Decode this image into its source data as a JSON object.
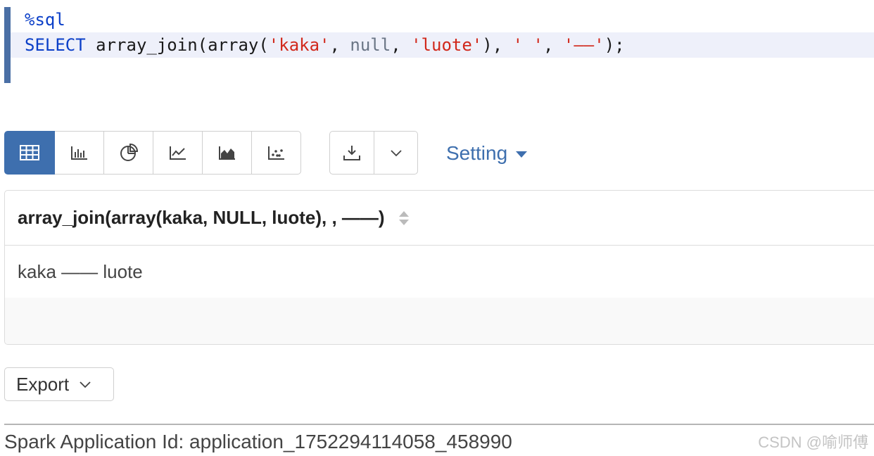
{
  "editor": {
    "line1": "%sql",
    "line2": {
      "kw": "SELECT",
      "p1": " array_join(array(",
      "s1": "'kaka'",
      "p2": ", ",
      "nul": "null",
      "p3": ", ",
      "s2": "'luote'",
      "p4": "), ",
      "s3": "' '",
      "p5": ", ",
      "s4": "'——'",
      "p6": ");"
    }
  },
  "toolbar": {
    "buttons": [
      {
        "icon": "table-icon",
        "active": true
      },
      {
        "icon": "bar-chart-icon",
        "active": false
      },
      {
        "icon": "pie-chart-icon",
        "active": false
      },
      {
        "icon": "line-chart-icon",
        "active": false
      },
      {
        "icon": "area-chart-icon",
        "active": false
      },
      {
        "icon": "scatter-chart-icon",
        "active": false
      }
    ],
    "download_icon": "download-icon",
    "dropdown_icon": "chevron-down-icon",
    "setting_label": "Setting"
  },
  "table": {
    "columns": [
      "array_join(array(kaka, NULL, luote), , ——)"
    ],
    "rows": [
      [
        "kaka —— luote"
      ]
    ]
  },
  "export": {
    "label": "Export"
  },
  "footer": {
    "text": "Spark Application Id: application_1752294114058_458990",
    "watermark": "CSDN @喻师傅"
  },
  "colors": {
    "accent": "#3e6fae",
    "keyword": "#0b3fc8",
    "string": "#d1281b",
    "null": "#6a7585"
  }
}
